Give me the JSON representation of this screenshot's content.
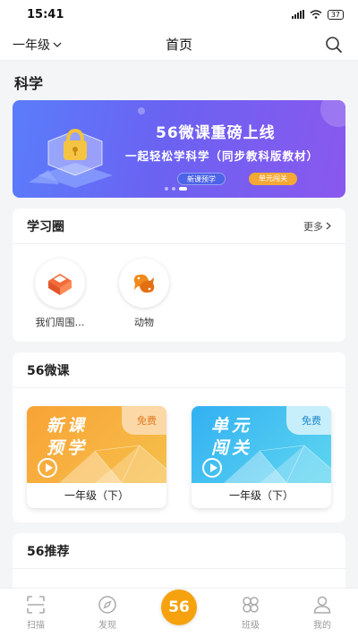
{
  "status": {
    "time": "15:41",
    "battery": "37"
  },
  "header": {
    "grade": "一年级",
    "title": "首页"
  },
  "subject": "科学",
  "banner": {
    "title": "56微课重磅上线",
    "subtitle": "一起轻松学科学（同步教科版教材）",
    "tag1": "新课预学",
    "tag2": "单元闯关"
  },
  "circle": {
    "title": "学习圈",
    "more": "更多",
    "items": [
      {
        "label": "我们周围…",
        "icon": "box-icon"
      },
      {
        "label": "动物",
        "icon": "fish-icon"
      }
    ]
  },
  "micro": {
    "title": "56微课",
    "courses": [
      {
        "name_line1": "新课",
        "name_line2": "预学",
        "badge": "免费",
        "grade": "一年级（下）",
        "theme": "orange"
      },
      {
        "name_line1": "单元",
        "name_line2": "闯关",
        "badge": "免费",
        "grade": "一年级（下）",
        "theme": "blue"
      }
    ]
  },
  "recommend": {
    "title": "56推荐"
  },
  "tabbar": {
    "scan": "扫描",
    "discover": "发现",
    "center": "56",
    "class": "班级",
    "mine": "我的"
  },
  "colors": {
    "accent": "#f5a20e",
    "banner": "#6b62f2"
  }
}
